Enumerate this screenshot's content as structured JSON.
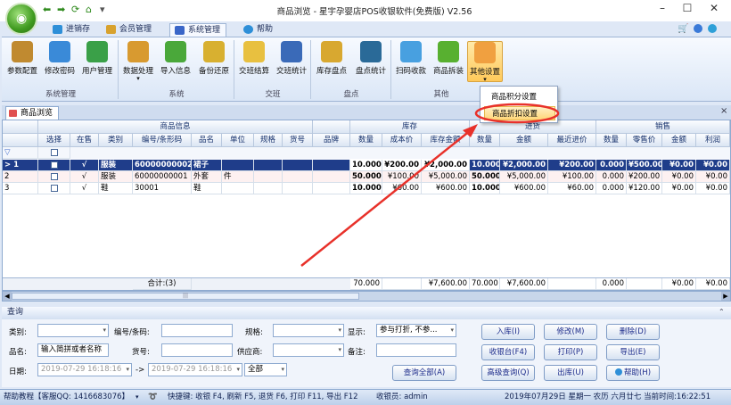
{
  "window": {
    "title": "商品浏览 - 星宇孕婴店POS收银软件(免费版) V2.56",
    "controls": [
      "–",
      "☐",
      "✕"
    ],
    "right_icons": [
      "🛒",
      "●",
      "🔵▾"
    ]
  },
  "ribbon_tabs": [
    {
      "label": "进销存",
      "color": "#2e8fd8"
    },
    {
      "label": "会员管理",
      "color": "#d8a22e"
    },
    {
      "label": "系统管理",
      "color": "#3a66c8"
    },
    {
      "label": "帮助",
      "color": "#2e8fd8"
    }
  ],
  "ribbon": {
    "buttons": [
      {
        "label": "参数配置",
        "icon": "wrench-icon",
        "color": "#c08a30"
      },
      {
        "label": "修改密码",
        "icon": "key-icon",
        "color": "#3a8ad8"
      },
      {
        "label": "用户管理",
        "icon": "users-icon",
        "color": "#3aa048"
      },
      {
        "label": "数据处理",
        "icon": "database-icon",
        "color": "#d89a30"
      },
      {
        "label": "导入信息",
        "icon": "import-icon",
        "color": "#4aa83a"
      },
      {
        "label": "备份还原",
        "icon": "backup-icon",
        "color": "#d8b030"
      },
      {
        "label": "交班结算",
        "icon": "handover-icon",
        "color": "#e8c040"
      },
      {
        "label": "交班统计",
        "icon": "stats-icon",
        "color": "#3a6ab8"
      },
      {
        "label": "库存盘点",
        "icon": "inventory-icon",
        "color": "#d8a830"
      },
      {
        "label": "盘点统计",
        "icon": "count-stats-icon",
        "color": "#2a6a98"
      },
      {
        "label": "扫码收款",
        "icon": "qrcode-icon",
        "color": "#48a0e0"
      },
      {
        "label": "商品拆装",
        "icon": "split-icon",
        "color": "#58b030"
      },
      {
        "label": "其他设置",
        "icon": "other-settings-icon",
        "color": "#f0a040"
      }
    ],
    "groups": [
      "系统管理",
      "系统",
      "交班",
      "盘点",
      "其他"
    ]
  },
  "dropdown_menu": {
    "items": [
      "商品积分设置",
      "商品折扣设置"
    ]
  },
  "document_tab": "商品浏览",
  "grid": {
    "group_headers": [
      "商品信息",
      "库存",
      "进货",
      "销售"
    ],
    "columns": [
      "选择",
      "在售",
      "类别",
      "编号/条形码",
      "品名",
      "单位",
      "规格",
      "货号",
      "品牌",
      "数量",
      "成本价",
      "库存金额",
      "数量",
      "金额",
      "最近进价",
      "数量",
      "零售价",
      "金额",
      "利润"
    ],
    "filter_row_marker": "▽",
    "rows": [
      {
        "idx": "1",
        "on_sale": "√",
        "cells": [
          "服装",
          "60000000002",
          "裙子",
          "",
          "",
          "",
          "",
          "10.000",
          "¥200.00",
          "¥2,000.00",
          "10.000",
          "¥2,000.00",
          "¥200.00",
          "0.000",
          "¥500.00",
          "¥0.00",
          "¥0.00"
        ]
      },
      {
        "idx": "2",
        "on_sale": "√",
        "cells": [
          "服装",
          "60000000001",
          "外套",
          "件",
          "",
          "",
          "",
          "50.000",
          "¥100.00",
          "¥5,000.00",
          "50.000",
          "¥5,000.00",
          "¥100.00",
          "0.000",
          "¥200.00",
          "¥0.00",
          "¥0.00"
        ]
      },
      {
        "idx": "3",
        "on_sale": "√",
        "cells": [
          "鞋",
          "30001",
          "鞋",
          "",
          "",
          "",
          "",
          "10.000",
          "¥60.00",
          "¥600.00",
          "10.000",
          "¥600.00",
          "¥60.00",
          "0.000",
          "¥120.00",
          "¥0.00",
          "¥0.00"
        ]
      }
    ],
    "summary": {
      "label": "合计:(3)",
      "values": [
        "70.000",
        "",
        "¥7,600.00",
        "70.000",
        "¥7,600.00",
        "",
        "0.000",
        "",
        "¥0.00",
        "¥0.00"
      ]
    },
    "scroll_marker": "|||"
  },
  "query": {
    "header": "查询",
    "labels": {
      "category": "类别:",
      "code": "编号/条码:",
      "spec": "规格:",
      "display": "显示:",
      "name": "品名:",
      "item_no": "货号:",
      "supplier": "供应商:",
      "note": "备注:",
      "date": "日期:",
      "to": "->"
    },
    "values": {
      "display": "参与打折, 不参...",
      "name_placeholder": "输入简拼或者名称",
      "date_from": "2019-07-29 16:18:16",
      "date_to": "2019-07-29 16:18:16",
      "range": "全部"
    },
    "buttons": [
      "查询全部(A)",
      "入库(I)",
      "修改(M)",
      "删除(D)",
      "收银台(F4)",
      "打印(P)",
      "导出(E)",
      "高级查询(Q)",
      "出库(U)",
      "帮助(H)"
    ]
  },
  "status_bar": {
    "help": "帮助教程【客服QQ: 1416683076】",
    "shortcuts": "快捷键: 收银 F4, 刷新 F5, 退货 F6, 打印 F11, 导出 F12",
    "cashier": "收银员: admin",
    "datetime": "2019年07月29日 星期一 农历 六月廿七 当前时间:16:22:51"
  },
  "colors": {
    "accent": "#3a66c8",
    "arrow": "#e8312a",
    "highlight": "#e8312a"
  }
}
